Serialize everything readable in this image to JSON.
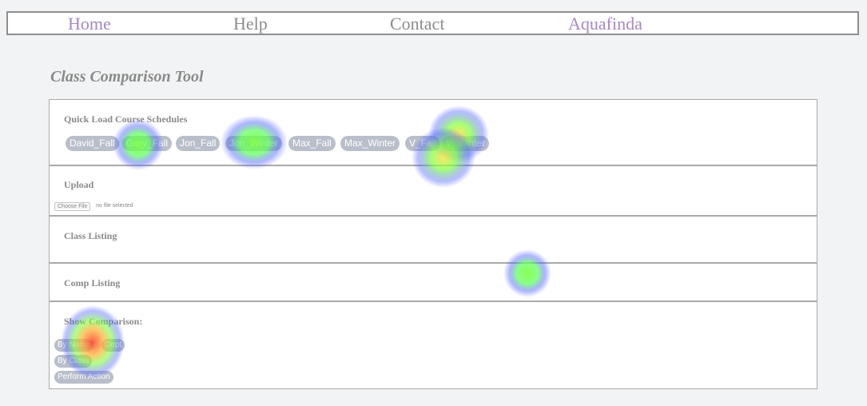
{
  "nav": {
    "home": "Home",
    "help": "Help",
    "contact": "Contact",
    "aquafinda": "Aquafinda"
  },
  "title": "Class Comparison Tool",
  "sections": {
    "quick_load": {
      "heading": "Quick Load Course Schedules",
      "schedules": [
        "David_Fall",
        "Gary_Fall",
        "Jon_Fall",
        "Jon_Winter",
        "Max_Fall",
        "Max_Winter",
        "V_Fall",
        "V_Winter"
      ]
    },
    "upload": {
      "heading": "Upload",
      "choose_file": "Choose File",
      "no_file": "no file selected"
    },
    "class_listing": {
      "heading": "Class Listing"
    },
    "comp_listing": {
      "heading": "Comp Listing"
    },
    "show_comparison": {
      "heading": "Show Comparison:",
      "by_name": "By Name",
      "dept": "Dept",
      "by_class": "By Class",
      "perform_action": "Perform Action"
    }
  },
  "colors": {
    "nav_accent": "#a788c2",
    "nav_text": "#8c8c8c",
    "pill_bg": "#b9bfca",
    "page_bg": "#f2f3f4"
  }
}
